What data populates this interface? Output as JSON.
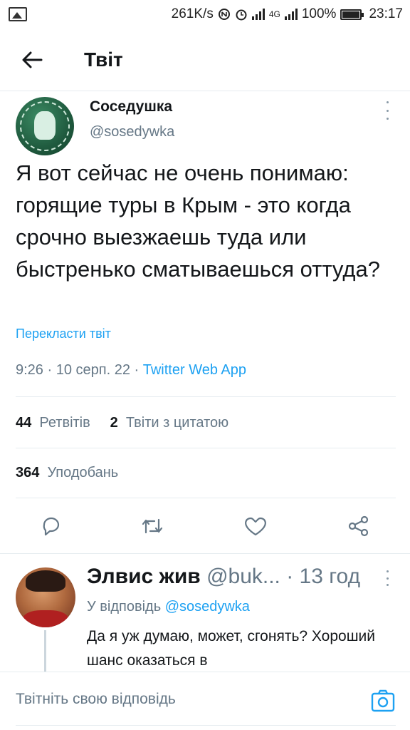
{
  "status_bar": {
    "speed": "261K/s",
    "network": "4G",
    "battery": "100%",
    "time": "23:17"
  },
  "header": {
    "title": "Твіт"
  },
  "tweet": {
    "author_name": "Соседушка",
    "author_handle": "@sosedywka",
    "text": "Я вот сейчас не очень понимаю: горящие туры в Крым - это когда срочно выезжаешь туда или быстренько сматываешься оттуда?",
    "translate_label": "Перекласти твіт",
    "meta": {
      "time": "9:26",
      "date": "10 серп. 22",
      "app": "Twitter Web App"
    },
    "stats": {
      "retweets_count": "44",
      "retweets_label": "Ретвітів",
      "quotes_count": "2",
      "quotes_label": "Твіти з цитатою",
      "likes_count": "364",
      "likes_label": "Уподобань"
    }
  },
  "reply": {
    "name": "Элвис жив",
    "handle": "@buk...",
    "time": "· 13 год",
    "reply_to_label": "У відповідь",
    "reply_to_handle": "@sosedywka",
    "text": "Да я уж думаю, может, сгонять? Хороший шанс оказаться в"
  },
  "compose": {
    "placeholder": "Твітніть свою відповідь"
  },
  "icons": {
    "back": "arrow-left-icon",
    "reply": "comment-icon",
    "retweet": "retweet-icon",
    "like": "heart-icon",
    "share": "share-icon",
    "camera": "camera-icon"
  },
  "colors": {
    "accent": "#1da1f2",
    "secondary_text": "#657786",
    "divider": "#e6ecf0"
  }
}
